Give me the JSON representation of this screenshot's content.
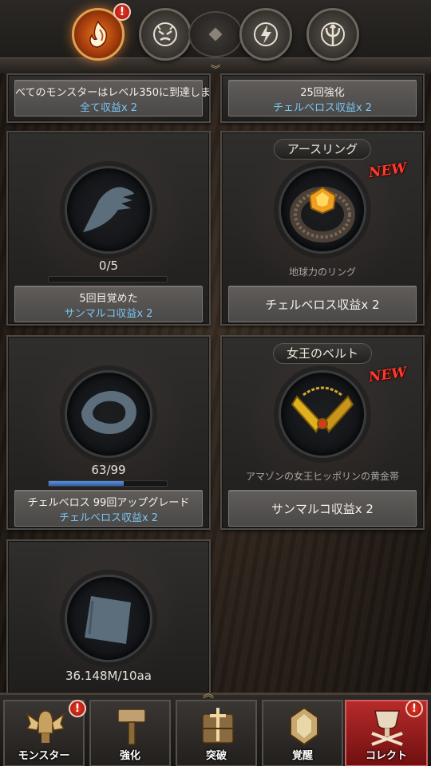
{
  "top_tabs": [
    {
      "icon": "fire-emblem-icon",
      "active": true,
      "badge": "!"
    },
    {
      "icon": "demon-face-emblem-icon",
      "active": false
    },
    {
      "icon": "lightning-emblem-icon",
      "active": false
    },
    {
      "icon": "trident-emblem-icon",
      "active": false
    }
  ],
  "cards": {
    "top_left": {
      "line1": "べてのモンスターはレベル350に到達しま",
      "line2": "全て収益x 2"
    },
    "top_right": {
      "line1": "25回強化",
      "line2": "チェルベロス収益x 2"
    },
    "awaken": {
      "progress": "0/5",
      "progress_fraction": 0,
      "line1": "5回目覚めた",
      "line2": "サンマルコ収益x 2"
    },
    "earth_ring": {
      "title": "アースリング",
      "new": "NEW",
      "desc": "地球力のリング",
      "reward": "チェルベロス収益x 2"
    },
    "upgrade": {
      "progress": "63/99",
      "progress_fraction": 0.636,
      "line1": "チェルベロス 99回アップグレード",
      "line2": "チェルベロス収益x 2"
    },
    "queen_belt": {
      "title": "女王のベルト",
      "new": "NEW",
      "desc": "アマゾンの女王ヒッポリンの黄金帯",
      "reward": "サンマルコ収益x 2"
    },
    "income": {
      "progress": "36.148M/10aa"
    }
  },
  "bottom_nav": [
    {
      "label": "モンスター",
      "icon": "winged-helmet-icon",
      "badge": "!"
    },
    {
      "label": "強化",
      "icon": "hammer-icon"
    },
    {
      "label": "突破",
      "icon": "sword-gate-icon"
    },
    {
      "label": "覚醒",
      "icon": "crystal-icon"
    },
    {
      "label": "コレクト",
      "icon": "trophy-collect-icon",
      "badge": "!",
      "active": true
    }
  ],
  "colors": {
    "accent_blue": "#79c6f4",
    "new_red": "#ff3a2a",
    "active_tab": "#e8761c",
    "active_nav": "#b82a2a"
  }
}
